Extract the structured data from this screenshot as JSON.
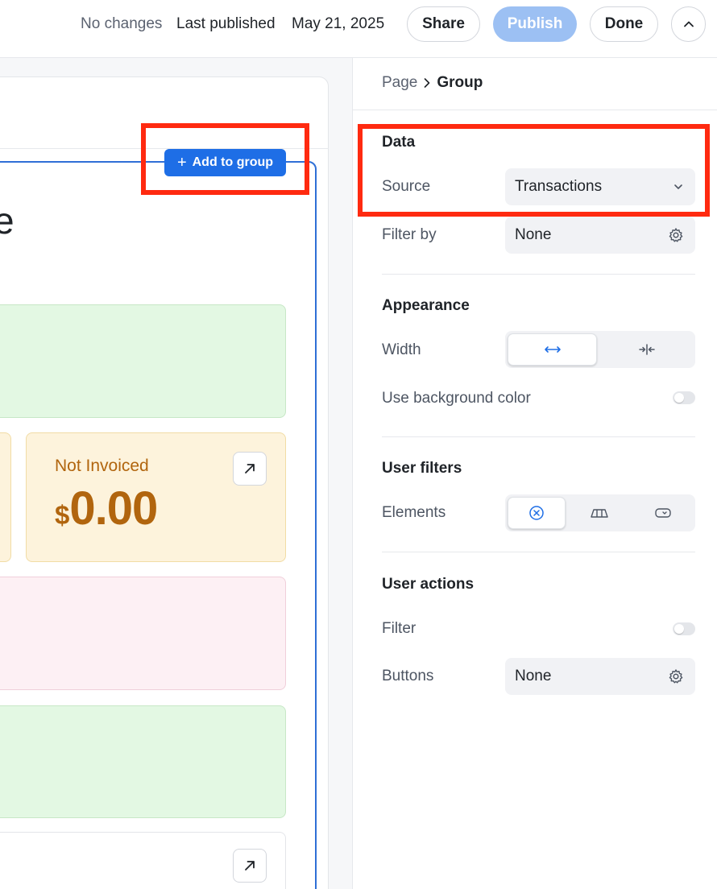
{
  "topbar": {
    "status": "No changes",
    "last_published_label": "Last published",
    "last_published_date": "May 21, 2025",
    "share_label": "Share",
    "publish_label": "Publish",
    "done_label": "Done"
  },
  "canvas": {
    "add_to_group_label": "Add to group",
    "partial_heading": "e",
    "tiles": {
      "not_invoiced": {
        "title": "Not Invoiced",
        "currency": "$",
        "value": "0.00"
      }
    }
  },
  "panel": {
    "breadcrumb": [
      "Page",
      "Group"
    ],
    "data_section": {
      "title": "Data",
      "source_label": "Source",
      "source_value": "Transactions",
      "filter_label": "Filter by",
      "filter_value": "None"
    },
    "appearance_section": {
      "title": "Appearance",
      "width_label": "Width",
      "width_options": [
        "full-width-icon",
        "centered-width-icon"
      ],
      "width_selected": 0,
      "bg_color_label": "Use background color",
      "bg_color_enabled": false
    },
    "user_filters_section": {
      "title": "User filters",
      "elements_label": "Elements",
      "element_options": [
        "none-icon",
        "tabs-icon",
        "dropdown-icon"
      ],
      "element_selected": 0
    },
    "user_actions_section": {
      "title": "User actions",
      "filter_label": "Filter",
      "filter_enabled": false,
      "buttons_label": "Buttons",
      "buttons_value": "None"
    }
  },
  "colors": {
    "accent": "#1e6ee6",
    "publish_disabled": "#9cc0f3",
    "highlight": "#ff2a10",
    "tile_amber_text": "#b1650e"
  }
}
